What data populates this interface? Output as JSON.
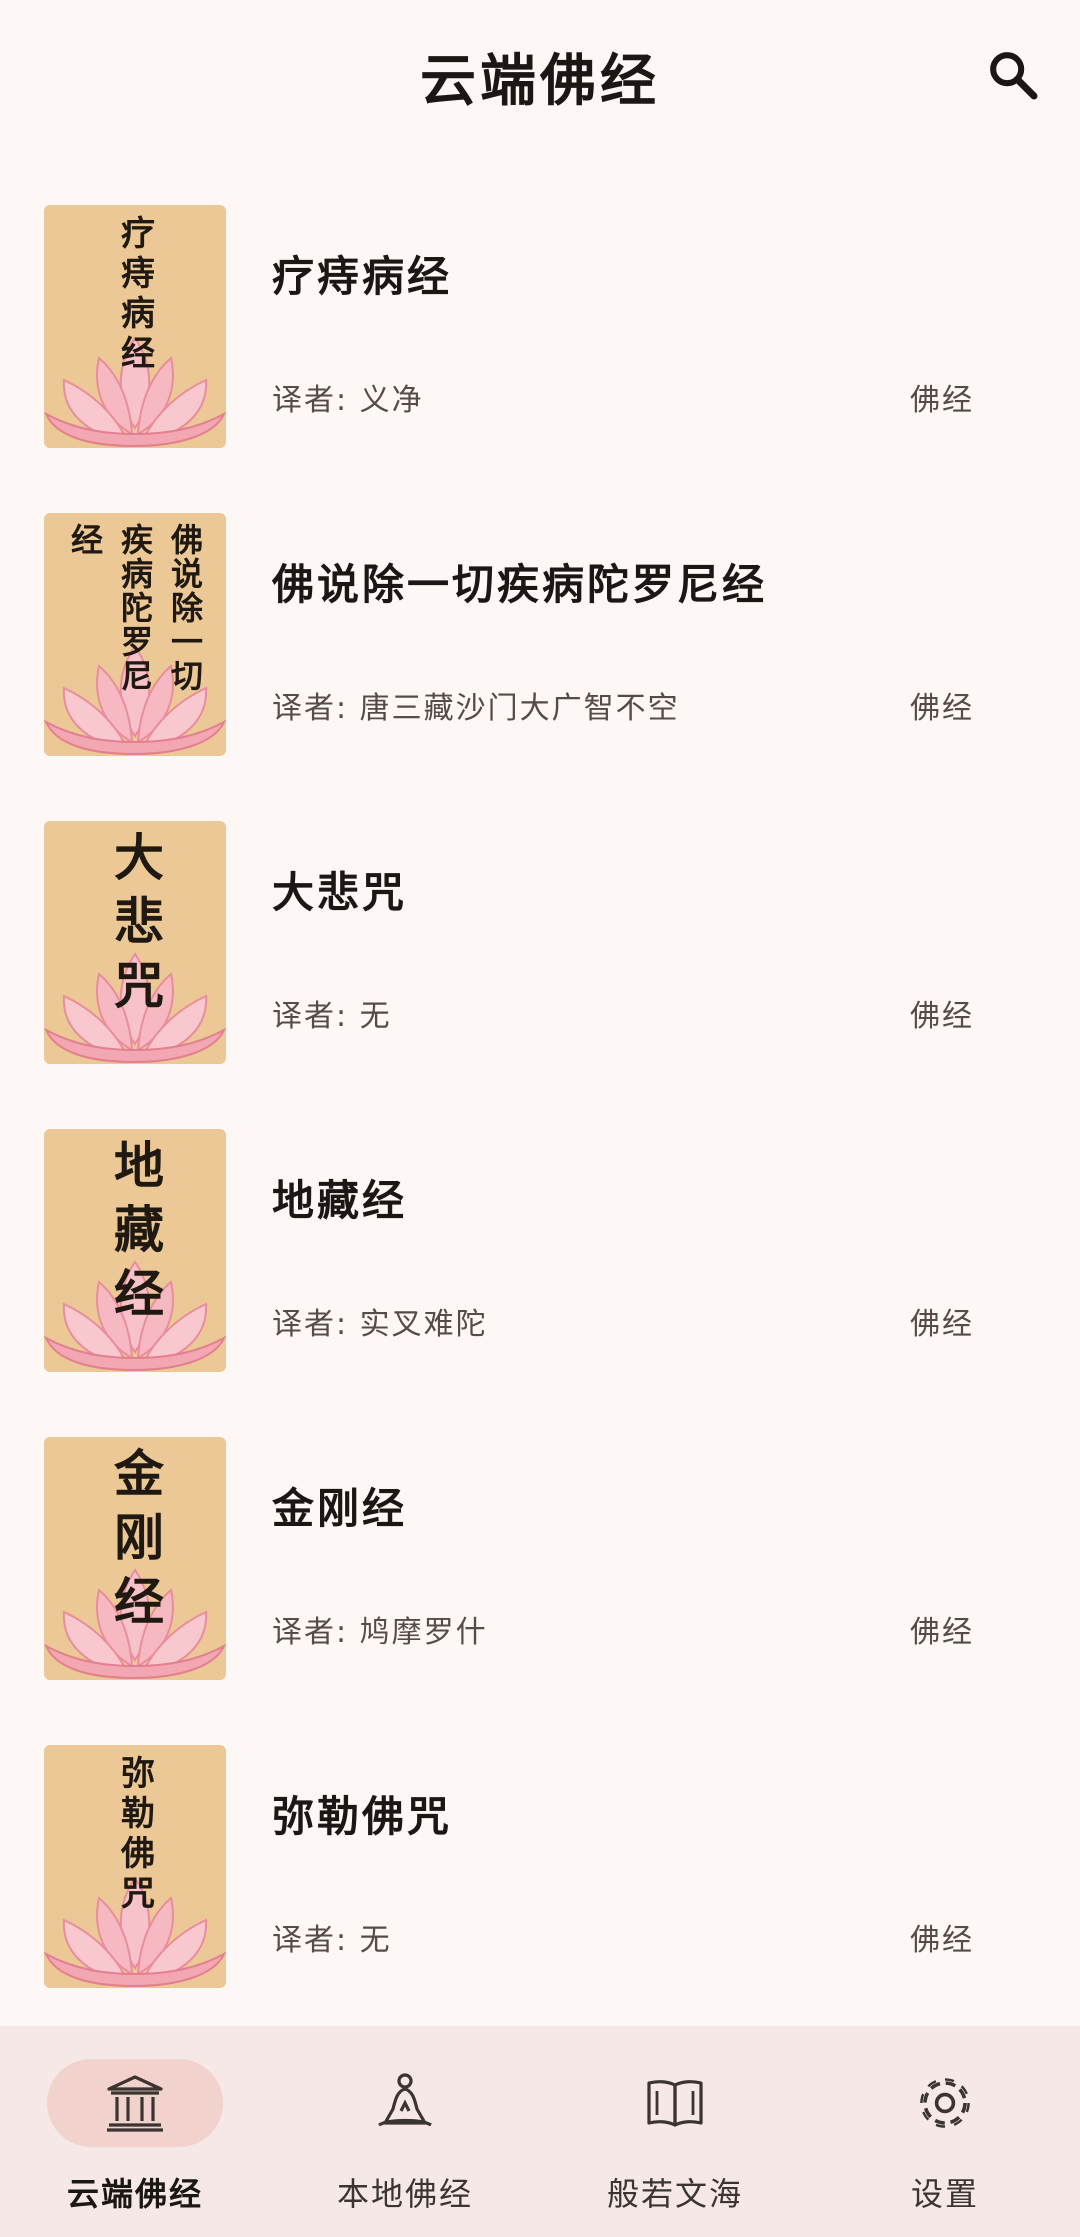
{
  "header": {
    "title": "云端佛经"
  },
  "icons": {
    "search": "search-icon",
    "lotus": "lotus-icon",
    "temple": "temple-icon",
    "meditate": "meditating-person-icon",
    "book": "open-book-icon",
    "gear": "gear-icon"
  },
  "colors": {
    "background": "#fdf8f5",
    "cover": "#ebc895",
    "nav_background": "#f5e8e6",
    "nav_active_pill": "#f2d2cd"
  },
  "sutras": [
    {
      "title": "疗痔病经",
      "translator": "译者: 义净",
      "category": "佛经",
      "cover_columns": [
        "疗痔病经"
      ]
    },
    {
      "title": "佛说除一切疾病陀罗尼经",
      "translator": "译者: 唐三藏沙门大广智不空",
      "category": "佛经",
      "cover_columns": [
        "佛说除一切",
        "疾病陀罗尼",
        "经"
      ]
    },
    {
      "title": "大悲咒",
      "translator": "译者: 无",
      "category": "佛经",
      "cover_columns": [
        "大悲咒"
      ]
    },
    {
      "title": "地藏经",
      "translator": "译者: 实叉难陀",
      "category": "佛经",
      "cover_columns": [
        "地藏经"
      ]
    },
    {
      "title": "金刚经",
      "translator": "译者: 鸠摩罗什",
      "category": "佛经",
      "cover_columns": [
        "金刚经"
      ]
    },
    {
      "title": "弥勒佛咒",
      "translator": "译者: 无",
      "category": "佛经",
      "cover_columns": [
        "弥勒佛咒"
      ]
    }
  ],
  "nav": {
    "tabs": [
      {
        "label": "云端佛经",
        "active": true
      },
      {
        "label": "本地佛经",
        "active": false
      },
      {
        "label": "般若文海",
        "active": false
      },
      {
        "label": "设置",
        "active": false
      }
    ]
  }
}
